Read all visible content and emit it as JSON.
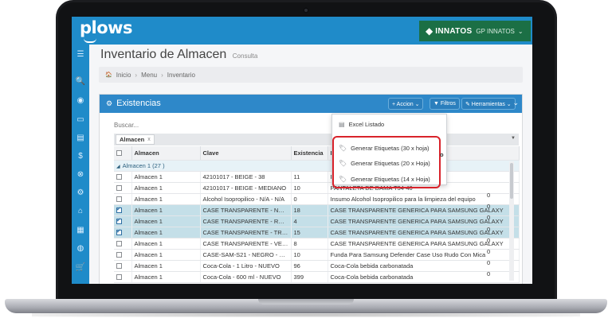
{
  "app": {
    "logo_text": "plows",
    "brand_name": "INNATOS",
    "brand_sub": "GP INNATOS",
    "brand_caret": "⌄",
    "brand_mark": "◆"
  },
  "page": {
    "title": "Inventario de Almacen",
    "subtitle": "Consulta"
  },
  "breadcrumb": {
    "home": "Inicio",
    "items": [
      "Menu",
      "Inventario"
    ],
    "sep": "›",
    "home_icon": "🏠"
  },
  "panel": {
    "title": "Existencias",
    "buttons": {
      "accion": "+ Accion ⌄",
      "filtros": "▼ Filtros",
      "herramientas": "✎ Herramientas ⌄"
    },
    "collapse_icon": "⌄"
  },
  "search": {
    "placeholder": "Buscar..."
  },
  "grouping": {
    "chip": "Almacen",
    "remove": "x"
  },
  "grid": {
    "headers": [
      "Almacen",
      "Clave",
      "Existencia",
      "Descripcion"
    ],
    "group_label": "Almacen 1 (27 )",
    "rows": [
      {
        "almacen": "Almacen 1",
        "clave": "42101017 - BEIGE - 38",
        "existencia": "11",
        "descripcion": "PANTALETA DE DAMA T34-40",
        "checked": false
      },
      {
        "almacen": "Almacen 1",
        "clave": "42101017 - BEIGE - MEDIANO",
        "existencia": "10",
        "descripcion": "PANTALETA DE DAMA T34-40",
        "checked": false
      },
      {
        "almacen": "Almacen 1",
        "clave": "Alcohol Isopropilico - N/A - N/A",
        "existencia": "0",
        "descripcion": "Insumo Alcohol Isopropilico para la limpieza del equipo",
        "checked": false
      },
      {
        "almacen": "Almacen 1",
        "clave": "CASE TRANSPARENTE - NEGRO - N/A",
        "existencia": "18",
        "descripcion": "CASE TRANSPARENTE GENERICA PARA SAMSUNG GALAXY",
        "checked": true
      },
      {
        "almacen": "Almacen 1",
        "clave": "CASE TRANSPARENTE - ROJO - N/A",
        "existencia": "4",
        "descripcion": "CASE TRANSPARENTE GENERICA PARA SAMSUNG GALAXY",
        "checked": true
      },
      {
        "almacen": "Almacen 1",
        "clave": "CASE TRANSPARENTE - TRANSPARENTE",
        "existencia": "15",
        "descripcion": "CASE TRANSPARENTE GENERICA PARA SAMSUNG GALAXY",
        "checked": true
      },
      {
        "almacen": "Almacen 1",
        "clave": "CASE TRANSPARENTE - VERDE - N/A",
        "existencia": "8",
        "descripcion": "CASE TRANSPARENTE GENERICA PARA SAMSUNG GALAXY",
        "checked": false
      },
      {
        "almacen": "Almacen 1",
        "clave": "CASE-SAM-S21 - NEGRO - NUEVO",
        "existencia": "10",
        "descripcion": "Funda Para Samsung Defender Case Uso Rudo Con Mica",
        "checked": false
      },
      {
        "almacen": "Almacen 1",
        "clave": "Coca-Cola - 1 Litro - NUEVO",
        "existencia": "96",
        "descripcion": "Coca-Cola bebida carbonatada",
        "checked": false
      },
      {
        "almacen": "Almacen 1",
        "clave": "Coca-Cola - 600 ml - NUEVO",
        "existencia": "399",
        "descripcion": "Coca-Cola bebida carbonatada",
        "checked": false
      }
    ],
    "extra_col": [
      "0",
      "0",
      "0",
      "0",
      "0",
      "0",
      "0",
      "0"
    ]
  },
  "dropdown": {
    "items": [
      {
        "label": "Excel Listado",
        "icon": "▤"
      },
      {
        "label": "Generar Etiquetas (30 x hoja)",
        "icon": "🏷"
      },
      {
        "label": "Generar Etiquetas (20 x Hoja)",
        "icon": "🏷"
      },
      {
        "label": "Generar Etiquetas (14 x Hoja)",
        "icon": "🏷"
      }
    ],
    "partial_header": "o"
  },
  "sidebar": {
    "icons": [
      "☰",
      "🔍",
      "◉",
      "▭",
      "▤",
      "$",
      "⊗",
      "⚙",
      "⌂",
      "▦",
      "◍",
      "🛒"
    ]
  }
}
